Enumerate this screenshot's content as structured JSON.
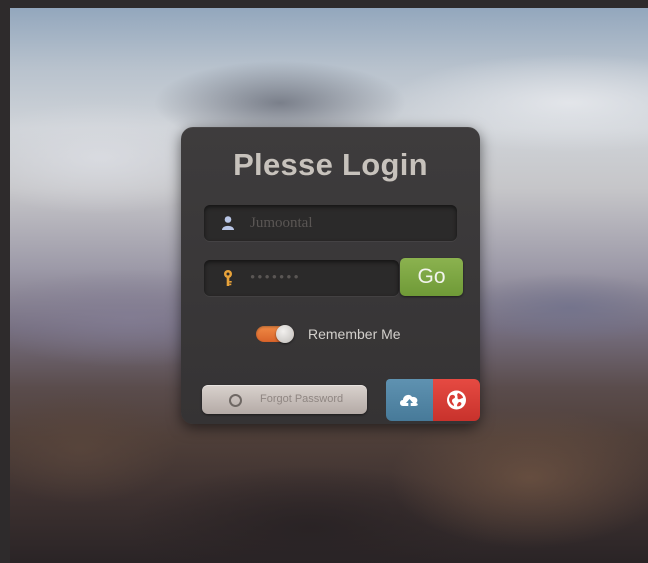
{
  "login": {
    "title": "Plesse Login",
    "username": {
      "value": "Jumoontal",
      "icon": "user-icon"
    },
    "password": {
      "value": "•••••••",
      "icon": "key-icon"
    },
    "go_label": "Go",
    "remember": {
      "label": "Remember Me",
      "checked": true
    },
    "forgot_label": "Forgot Password",
    "cloud_icon": "cloud-upload-icon",
    "globe_icon": "globe-icon"
  },
  "colors": {
    "go_button": "#7ba545",
    "toggle_on": "#e8763a",
    "cloud_button": "#5287a8",
    "globe_button": "#d93c35",
    "panel": "#3a3839"
  }
}
